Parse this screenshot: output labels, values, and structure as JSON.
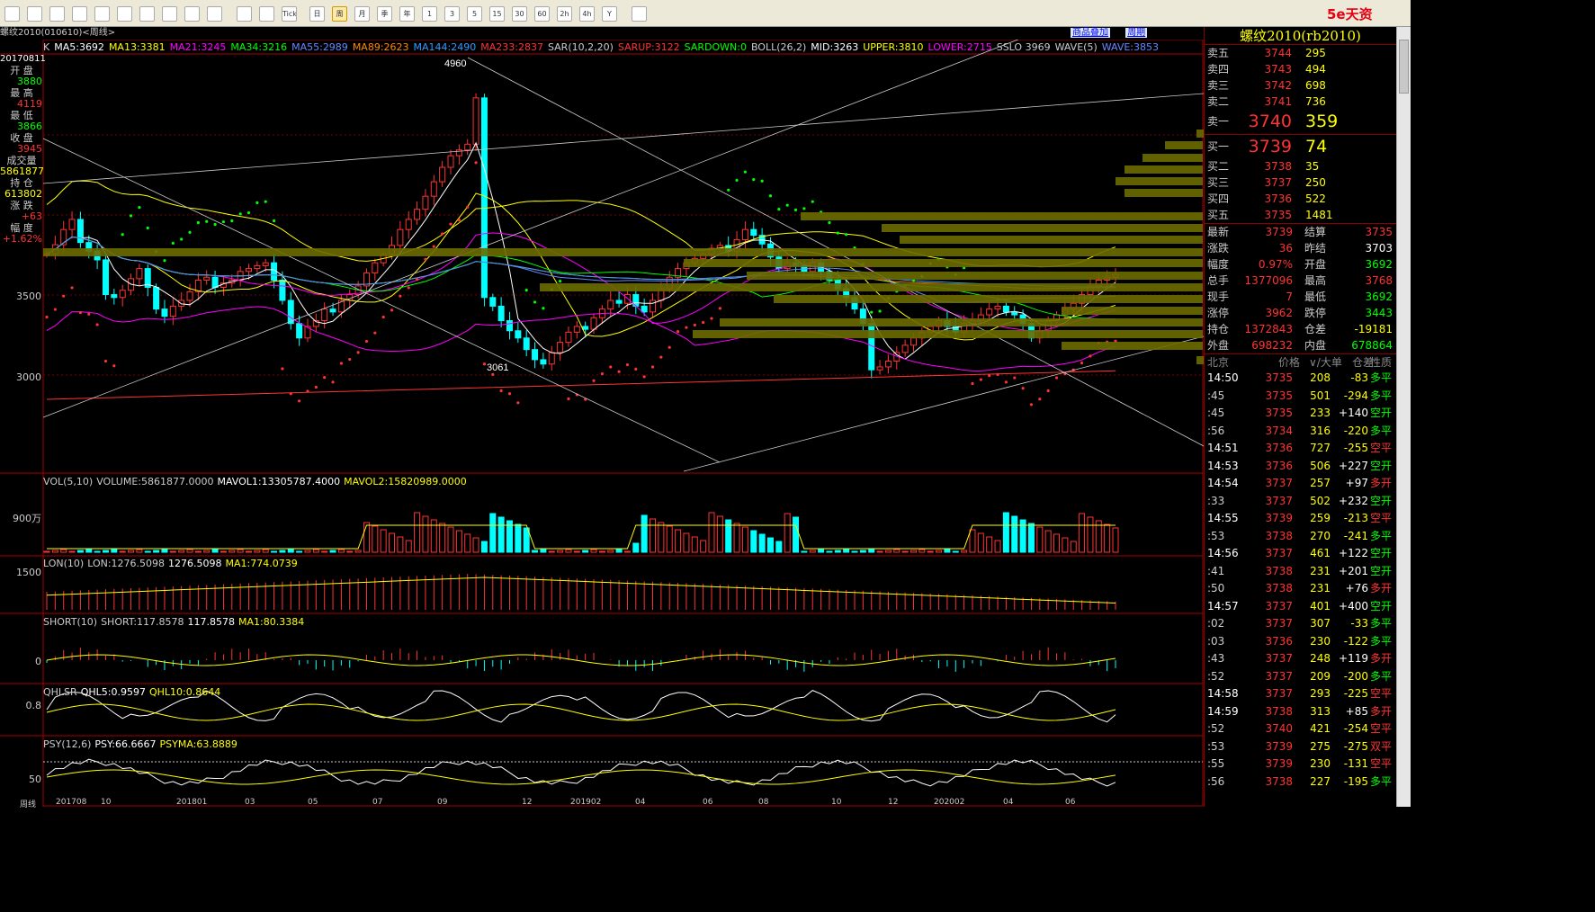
{
  "toolbar": {
    "tools": [
      "home-icon",
      "folder-icon",
      "news-icon",
      "refresh-icon",
      "search-icon",
      "zoom-icon",
      "draw-icon",
      "pen-icon",
      "lab-icon",
      "chart-icon",
      "table-icon",
      "line-chart-icon",
      "tick-icon",
      "day-icon",
      "week-icon",
      "month-icon",
      "season-icon",
      "year-icon",
      "1min-icon",
      "3min-icon",
      "5min-icon",
      "15min-icon",
      "30min-icon",
      "60min-icon",
      "2h-icon",
      "4h-icon",
      "Y-icon",
      "calc-icon"
    ],
    "labels": [
      "",
      "",
      "",
      "",
      "",
      "",
      "",
      "",
      "",
      "",
      "",
      "",
      "Tick",
      "日",
      "周",
      "月",
      "季",
      "年",
      "1",
      "3",
      "5",
      "15",
      "30",
      "60",
      "2h",
      "4h",
      "Y",
      ""
    ],
    "selected": 14,
    "brand": "5e天资"
  },
  "title": {
    "symbol": "螺纹2010(010610)<周线>",
    "link1": "商品叠加",
    "link2": "周期"
  },
  "legend": [
    {
      "t": "K",
      "c": "#ccc"
    },
    {
      "t": "MA5:3692",
      "c": "#fff"
    },
    {
      "t": "MA13:3381",
      "c": "#ff0"
    },
    {
      "t": "MA21:3245",
      "c": "#f0f"
    },
    {
      "t": "MA34:3216",
      "c": "#0f0"
    },
    {
      "t": "MA55:2989",
      "c": "#68f"
    },
    {
      "t": "MA89:2623",
      "c": "#f80"
    },
    {
      "t": "MA144:2490",
      "c": "#39f"
    },
    {
      "t": "MA233:2837",
      "c": "#f33"
    },
    {
      "t": "SAR(10,2,20)",
      "c": "#ccc"
    },
    {
      "t": "SARUP:3122",
      "c": "#f33"
    },
    {
      "t": "SARDOWN:0",
      "c": "#0f0"
    },
    {
      "t": "BOLL(26,2)",
      "c": "#ccc"
    },
    {
      "t": "MID:3263",
      "c": "#fff"
    },
    {
      "t": "UPPER:3810",
      "c": "#ff0"
    },
    {
      "t": "LOWER:2715",
      "c": "#f0f"
    },
    {
      "t": "SSLO 3969",
      "c": "#ccc"
    },
    {
      "t": "WAVE(5)",
      "c": "#ccc"
    },
    {
      "t": "WAVE:3853",
      "c": "#68f"
    }
  ],
  "left_info": [
    {
      "l": "20170811",
      "v": "",
      "cls": "wh"
    },
    {
      "l": "开 盘",
      "v": "3880",
      "cls": "dn"
    },
    {
      "l": "最 高",
      "v": "4119",
      "cls": "up"
    },
    {
      "l": "最 低",
      "v": "3866",
      "cls": "dn"
    },
    {
      "l": "收 盘",
      "v": "3945",
      "cls": "up"
    },
    {
      "l": "成交量",
      "v": "5861877",
      "cls": "ye"
    },
    {
      "l": "持 仓",
      "v": "613802",
      "cls": "ye"
    },
    {
      "l": "涨 跌",
      "v": "+63",
      "cls": "up"
    },
    {
      "l": "幅 度",
      "v": "+1.62%",
      "cls": "up"
    }
  ],
  "price_axis": {
    "labels": [
      "3500",
      "3000"
    ]
  },
  "annotations": {
    "high": "4960",
    "low": "3061"
  },
  "indicators": {
    "vol": {
      "legend": [
        {
          "t": "VOL(5,10)",
          "c": "#ccc"
        },
        {
          "t": "VOLUME:5861877.0000",
          "c": "#ccc"
        },
        {
          "t": "MAVOL1:13305787.4000",
          "c": "#fff"
        },
        {
          "t": "MAVOL2:15820989.0000",
          "c": "#ff0"
        }
      ],
      "axis": "900万"
    },
    "lon": {
      "legend": [
        {
          "t": "LON(10)",
          "c": "#ccc"
        },
        {
          "t": "LON:1276.5098",
          "c": "#ccc"
        },
        {
          "t": "1276.5098",
          "c": "#fff"
        },
        {
          "t": "MA1:774.0739",
          "c": "#ff0"
        }
      ],
      "axis": "1500"
    },
    "short": {
      "legend": [
        {
          "t": "SHORT(10)",
          "c": "#ccc"
        },
        {
          "t": "SHORT:117.8578",
          "c": "#ccc"
        },
        {
          "t": "117.8578",
          "c": "#fff"
        },
        {
          "t": "MA1:80.3384",
          "c": "#ff0"
        }
      ],
      "axis": "0"
    },
    "qhlsr": {
      "legend": [
        {
          "t": "QHLSR",
          "c": "#ccc"
        },
        {
          "t": "QHL5:0.9597",
          "c": "#fff"
        },
        {
          "t": "QHL10:0.8644",
          "c": "#ff0"
        }
      ],
      "axis": "0.8"
    },
    "psy": {
      "legend": [
        {
          "t": "PSY(12,6)",
          "c": "#ccc"
        },
        {
          "t": "PSY:66.6667",
          "c": "#fff"
        },
        {
          "t": "PSYMA:63.8889",
          "c": "#ff0"
        }
      ],
      "axis": "50"
    }
  },
  "x_axis": [
    "周线",
    "201708",
    "10",
    "201801",
    "03",
    "05",
    "07",
    "09",
    "12",
    "201902",
    "04",
    "06",
    "08",
    "10",
    "12",
    "202002",
    "04",
    "06"
  ],
  "quote": {
    "title": "螺纹2010(rb2010)",
    "asks": [
      {
        "l": "卖五",
        "p": "3744",
        "v": "295"
      },
      {
        "l": "卖四",
        "p": "3743",
        "v": "494"
      },
      {
        "l": "卖三",
        "p": "3742",
        "v": "698"
      },
      {
        "l": "卖二",
        "p": "3741",
        "v": "736"
      }
    ],
    "ask1": {
      "l": "卖一",
      "p": "3740",
      "v": "359"
    },
    "bid1": {
      "l": "买一",
      "p": "3739",
      "v": "74"
    },
    "bids": [
      {
        "l": "买二",
        "p": "3738",
        "v": "35"
      },
      {
        "l": "买三",
        "p": "3737",
        "v": "250"
      },
      {
        "l": "买四",
        "p": "3736",
        "v": "522"
      },
      {
        "l": "买五",
        "p": "3735",
        "v": "1481"
      }
    ],
    "stats": [
      {
        "l1": "最新",
        "v1": "3739",
        "c1": "up",
        "l2": "结算",
        "v2": "3735",
        "c2": "up"
      },
      {
        "l1": "涨跌",
        "v1": "36",
        "c1": "up",
        "l2": "昨结",
        "v2": "3703",
        "c2": "wh"
      },
      {
        "l1": "幅度",
        "v1": "0.97%",
        "c1": "up",
        "l2": "开盘",
        "v2": "3692",
        "c2": "dn"
      },
      {
        "l1": "总手",
        "v1": "1377096",
        "c1": "ye",
        "l2": "最高",
        "v2": "3768",
        "c2": "up"
      },
      {
        "l1": "现手",
        "v1": "7",
        "c1": "ye",
        "l2": "最低",
        "v2": "3692",
        "c2": "dn"
      },
      {
        "l1": "涨停",
        "v1": "3962",
        "c1": "up",
        "l2": "跌停",
        "v2": "3443",
        "c2": "dn"
      },
      {
        "l1": "持仓",
        "v1": "1372843",
        "c1": "ye",
        "l2": "仓差",
        "v2": "-19181",
        "c2": "ye"
      },
      {
        "l1": "外盘",
        "v1": "698232",
        "c1": "up",
        "l2": "内盘",
        "v2": "678864",
        "c2": "dn"
      }
    ],
    "tick_header": [
      "北京",
      "价格",
      "∨/大单",
      "仓差",
      "性质"
    ],
    "ticks": [
      {
        "t": "14:50",
        "b": true,
        "p": "3735",
        "v": "208",
        "o": "-83",
        "oc": "ye",
        "n": "多平",
        "nc": "dn"
      },
      {
        "t": ":45",
        "b": false,
        "p": "3735",
        "v": "501",
        "o": "-294",
        "oc": "ye",
        "n": "多平",
        "nc": "dn"
      },
      {
        "t": ":45",
        "b": false,
        "p": "3735",
        "v": "233",
        "o": "+140",
        "oc": "wh",
        "n": "空开",
        "nc": "dn"
      },
      {
        "t": ":56",
        "b": false,
        "p": "3734",
        "v": "316",
        "o": "-220",
        "oc": "ye",
        "n": "多平",
        "nc": "dn"
      },
      {
        "t": "14:51",
        "b": true,
        "p": "3736",
        "v": "727",
        "o": "-255",
        "oc": "ye",
        "n": "空平",
        "nc": "up"
      },
      {
        "t": "14:53",
        "b": true,
        "p": "3736",
        "v": "506",
        "o": "+227",
        "oc": "wh",
        "n": "空开",
        "nc": "dn"
      },
      {
        "t": "14:54",
        "b": true,
        "p": "3737",
        "v": "257",
        "o": "+97",
        "oc": "wh",
        "n": "多开",
        "nc": "up"
      },
      {
        "t": ":33",
        "b": false,
        "p": "3737",
        "v": "502",
        "o": "+232",
        "oc": "wh",
        "n": "空开",
        "nc": "dn"
      },
      {
        "t": "14:55",
        "b": true,
        "p": "3739",
        "v": "259",
        "o": "-213",
        "oc": "ye",
        "n": "空平",
        "nc": "up"
      },
      {
        "t": ":53",
        "b": false,
        "p": "3738",
        "v": "270",
        "o": "-241",
        "oc": "ye",
        "n": "多平",
        "nc": "dn"
      },
      {
        "t": "14:56",
        "b": true,
        "p": "3737",
        "v": "461",
        "o": "+122",
        "oc": "wh",
        "n": "空开",
        "nc": "dn"
      },
      {
        "t": ":41",
        "b": false,
        "p": "3738",
        "v": "231",
        "o": "+201",
        "oc": "wh",
        "n": "空开",
        "nc": "dn"
      },
      {
        "t": ":50",
        "b": false,
        "p": "3738",
        "v": "231",
        "o": "+76",
        "oc": "wh",
        "n": "多开",
        "nc": "up"
      },
      {
        "t": "14:57",
        "b": true,
        "p": "3737",
        "v": "401",
        "o": "+400",
        "oc": "wh",
        "n": "空开",
        "nc": "dn"
      },
      {
        "t": ":02",
        "b": false,
        "p": "3737",
        "v": "307",
        "o": "-33",
        "oc": "ye",
        "n": "多平",
        "nc": "dn"
      },
      {
        "t": ":03",
        "b": false,
        "p": "3736",
        "v": "230",
        "o": "-122",
        "oc": "ye",
        "n": "多平",
        "nc": "dn"
      },
      {
        "t": ":43",
        "b": false,
        "p": "3737",
        "v": "248",
        "o": "+119",
        "oc": "wh",
        "n": "多开",
        "nc": "up"
      },
      {
        "t": ":52",
        "b": false,
        "p": "3737",
        "v": "209",
        "o": "-200",
        "oc": "ye",
        "n": "多平",
        "nc": "dn"
      },
      {
        "t": "14:58",
        "b": true,
        "p": "3737",
        "v": "293",
        "o": "-225",
        "oc": "ye",
        "n": "空平",
        "nc": "up"
      },
      {
        "t": "14:59",
        "b": true,
        "p": "3738",
        "v": "313",
        "o": "+85",
        "oc": "wh",
        "n": "多开",
        "nc": "up"
      },
      {
        "t": ":52",
        "b": false,
        "p": "3740",
        "v": "421",
        "o": "-254",
        "oc": "ye",
        "n": "空平",
        "nc": "up"
      },
      {
        "t": ":53",
        "b": false,
        "p": "3739",
        "v": "275",
        "o": "-275",
        "oc": "ye",
        "n": "双平",
        "nc": "up"
      },
      {
        "t": ":55",
        "b": false,
        "p": "3739",
        "v": "230",
        "o": "-131",
        "oc": "ye",
        "n": "空平",
        "nc": "up"
      },
      {
        "t": ":56",
        "b": false,
        "p": "3738",
        "v": "227",
        "o": "-195",
        "oc": "ye",
        "n": "多平",
        "nc": "dn"
      }
    ]
  }
}
